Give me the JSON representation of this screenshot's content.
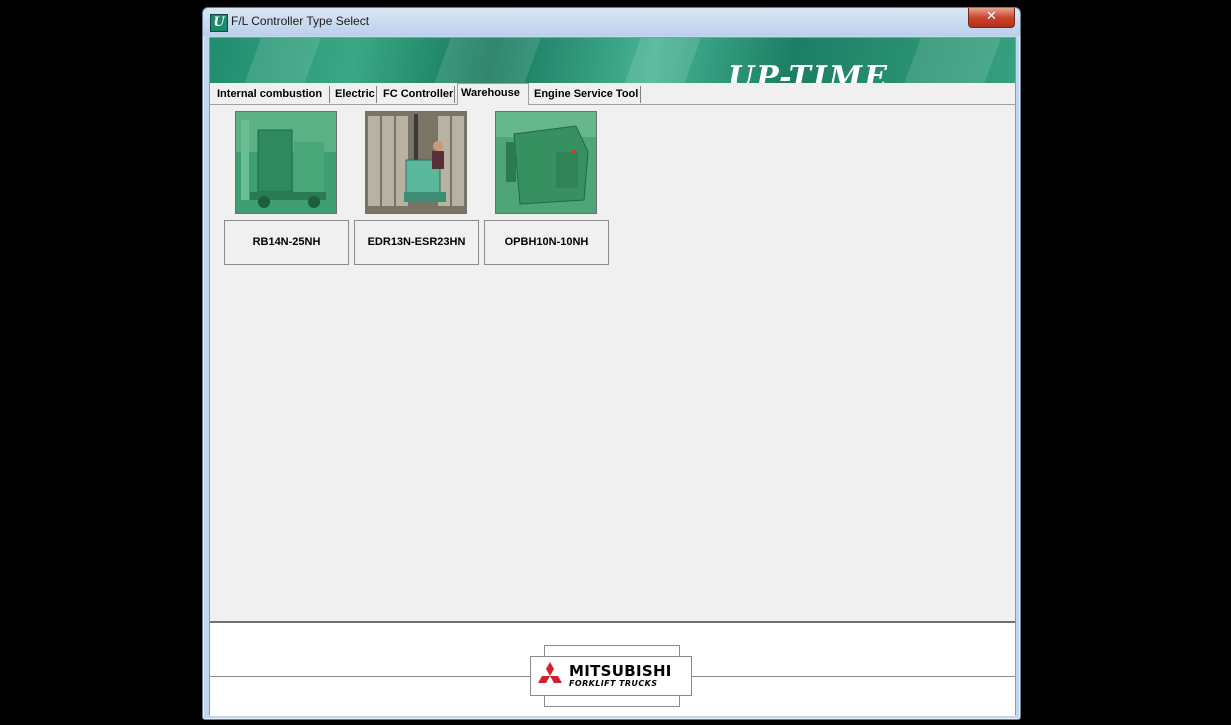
{
  "window": {
    "title": "F/L Controller Type Select",
    "icon": "U",
    "close_label": "✕"
  },
  "banner": {
    "logo_text": "UP-TIME"
  },
  "tabs": [
    {
      "label": "Internal combustion",
      "active": false
    },
    {
      "label": "Electric",
      "active": false
    },
    {
      "label": "FC Controller",
      "active": false
    },
    {
      "label": "Warehouse",
      "active": true
    },
    {
      "label": "Engine Service Tool",
      "active": false
    }
  ],
  "models": [
    {
      "label": "RB14N-25NH",
      "image": "reach-truck-photo"
    },
    {
      "label": "EDR13N-ESR23HN",
      "image": "order-picker-photo"
    },
    {
      "label": "OPBH10N-10NH",
      "image": "pallet-truck-photo"
    }
  ],
  "footer": {
    "brand": "MITSUBISHI",
    "brand_sub": "FORKLIFT TRUCKS",
    "brand_color": "#d2202e"
  }
}
